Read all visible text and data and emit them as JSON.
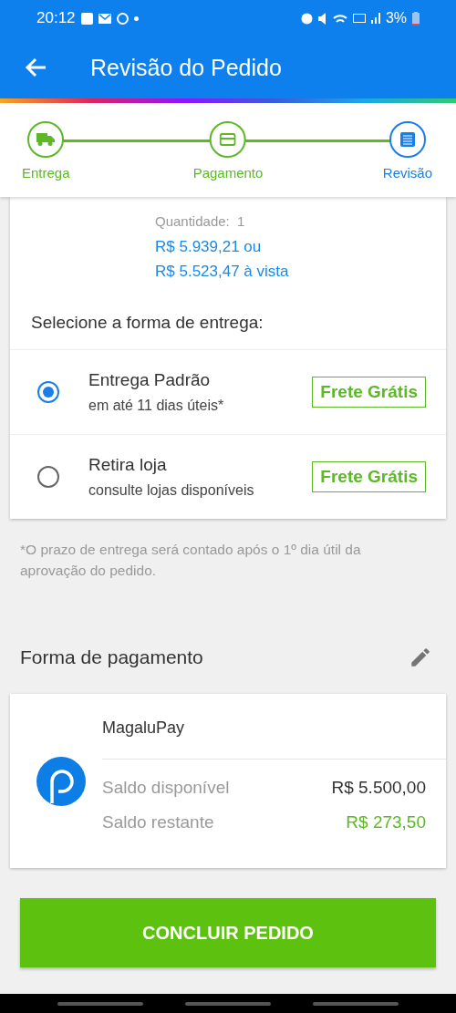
{
  "status_bar": {
    "time": "20:12",
    "battery": "3%"
  },
  "header": {
    "title": "Revisão do Pedido"
  },
  "steps": [
    {
      "label": "Entrega",
      "kind": "truck",
      "selected": false
    },
    {
      "label": "Pagamento",
      "kind": "card",
      "selected": false
    },
    {
      "label": "Revisão",
      "kind": "list",
      "selected": true
    }
  ],
  "product": {
    "quantity_label": "Quantidade:",
    "quantity": "1",
    "price_installments": "R$ 5.939,21 ou",
    "price_cash": "R$ 5.523,47 à vista"
  },
  "delivery": {
    "heading": "Selecione a forma de entrega:",
    "options": [
      {
        "name": "Entrega Padrão",
        "detail": "em até 11 dias úteis*",
        "tag": "Frete Grátis",
        "selected": true
      },
      {
        "name": "Retira loja",
        "detail": "consulte lojas disponíveis",
        "tag": "Frete Grátis",
        "selected": false
      }
    ]
  },
  "footnote": "*O prazo de entrega será contado após o 1º dia útil da aprovação do pedido.",
  "payment": {
    "heading": "Forma de pagamento",
    "method": "MagaluPay",
    "rows": [
      {
        "label": "Saldo disponível",
        "value": "R$ 5.500,00",
        "kind": "normal"
      },
      {
        "label": "Saldo restante",
        "value": "R$ 273,50",
        "kind": "positive"
      }
    ]
  },
  "submit": {
    "label": "CONCLUIR PEDIDO"
  }
}
